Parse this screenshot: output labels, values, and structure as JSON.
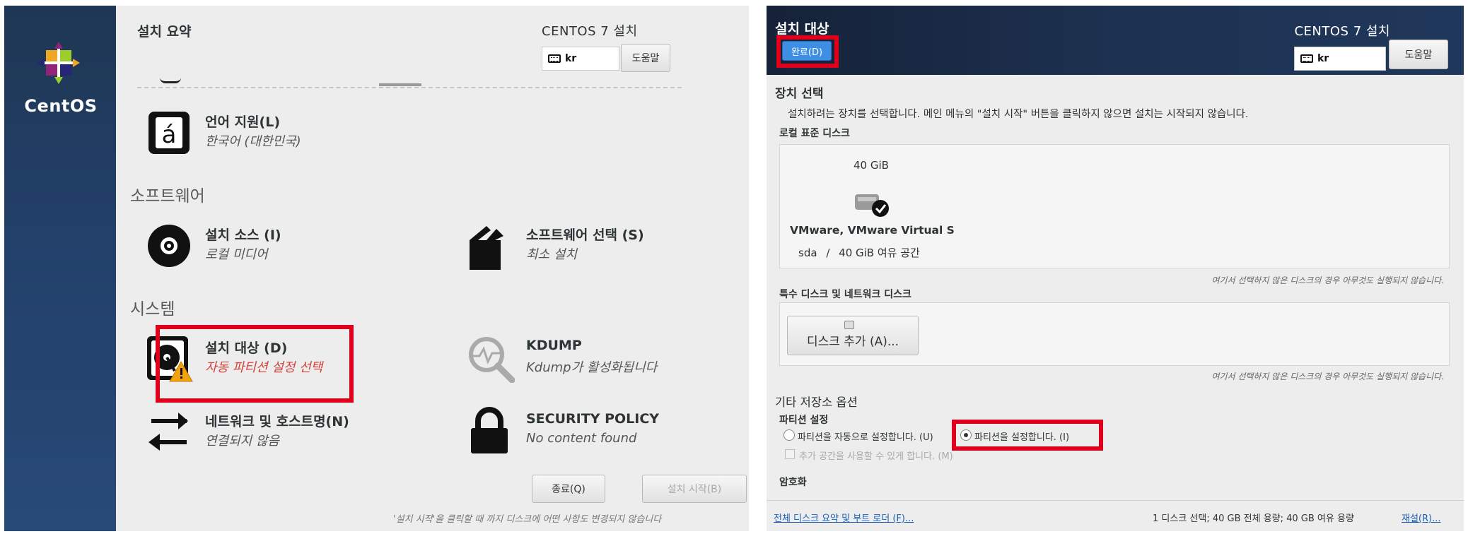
{
  "left_panel": {
    "brand": "CentOS",
    "header": {
      "title": "설치 요약",
      "right_title": "CENTOS 7 설치",
      "keyboard": "kr",
      "help_button": "도움말"
    },
    "sections": {
      "localization": {
        "language": {
          "title": "언어 지원(L)",
          "status": "한국어 (대한민국)",
          "icon": "language-icon"
        }
      },
      "software": {
        "title": "소프트웨어",
        "source": {
          "title": "설치 소스 (I)",
          "status": "로컬 미디어",
          "icon": "disc-icon"
        },
        "selection": {
          "title": "소프트웨어 선택 (S)",
          "status": "최소 설치",
          "icon": "package-icon"
        }
      },
      "system": {
        "title": "시스템",
        "destination": {
          "title": "설치 대상 (D)",
          "status": "자동 파티션 설정 선택",
          "icon": "hard-disk-warning-icon"
        },
        "kdump": {
          "title": "KDUMP",
          "status": "Kdump가 활성화됩니다",
          "icon": "magnifier-icon"
        },
        "network": {
          "title": "네트워크 및 호스트명(N)",
          "status": "연결되지 않음",
          "icon": "network-arrows-icon"
        },
        "security": {
          "title": "SECURITY POLICY",
          "status": "No content found",
          "icon": "padlock-icon"
        }
      }
    },
    "buttons": {
      "quit": "종료(Q)",
      "begin": "설치 시작(B)"
    },
    "footnote": "'설치 시작'을 클릭할 때 까지 디스크에 어떤 사항도 변경되지 않습니다"
  },
  "right_panel": {
    "header": {
      "title": "설치 대상",
      "done_button": "완료(D)",
      "right_title": "CENTOS 7 설치",
      "keyboard": "kr",
      "help_button": "도움말"
    },
    "device_selection": {
      "title": "장치 선택",
      "description": "설치하려는 장치를 선택합니다. 메인 메뉴의 \"설치 시작\" 버튼을 클릭하지 않으면 설치는 시작되지 않습니다.",
      "local_disks_title": "로컬 표준 디스크",
      "disk": {
        "size": "40 GiB",
        "name": "VMware, VMware Virtual S",
        "device": "sda",
        "separator": "/",
        "free": "40 GiB 여유 공간"
      },
      "note": "여기서 선택하지 않은 디스크의 경우 아무것도 실행되지 않습니다."
    },
    "specialized": {
      "title": "특수 디스크 및 네트워크 디스크",
      "add_disk_button": "디스크 추가 (A)...",
      "note": "여기서 선택하지 않은 디스크의 경우 아무것도 실행되지 않습니다."
    },
    "other_options": {
      "title": "기타 저장소 옵션",
      "partitioning_title": "파티션 설정",
      "auto_partition_radio": "파티션을 자동으로 설정합니다. (U)",
      "manual_partition_radio": "파티션을 설정합니다. (I)",
      "selected_partitioning": "manual",
      "extra_space_checkbox": "추가 공간을 사용할 수 있게 합니다. (M)",
      "encryption_title": "암호화"
    },
    "bottom": {
      "summary_link": "전체 디스크 요약 및 부트 로더 (F)...",
      "status": "1 디스크 선택; 40 GB 전체 용량; 40 GB 여유 용량",
      "refresh_link": "재설(R)..."
    }
  },
  "colors": {
    "highlight_red": "#e0001b",
    "sidebar_blue": "#22406a",
    "done_blue": "#3e8ee4",
    "warning": "#d2413a"
  }
}
